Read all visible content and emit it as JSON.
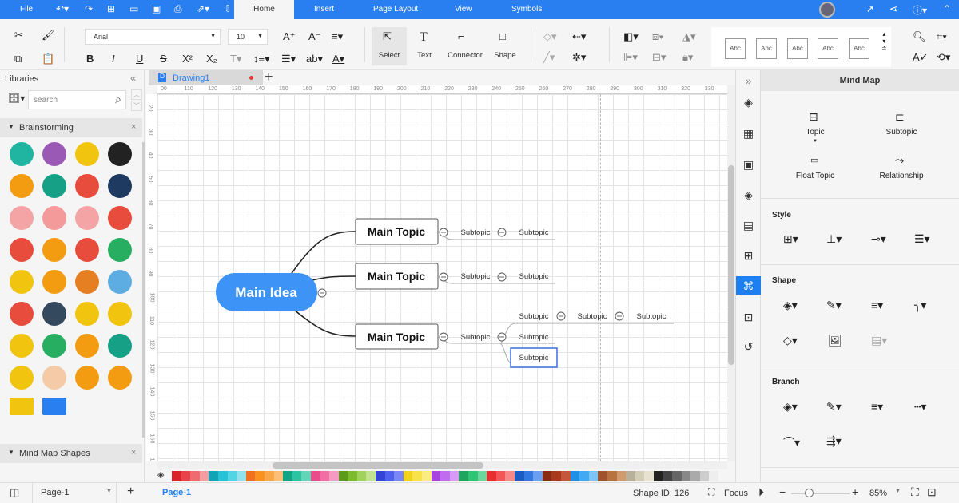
{
  "menu": {
    "file": "File",
    "tabs": [
      "Home",
      "Insert",
      "Page Layout",
      "View",
      "Symbols"
    ]
  },
  "toolbar": {
    "font": "Arial",
    "font_size": "10",
    "select": "Select",
    "text": "Text",
    "connector": "Connector",
    "shape": "Shape",
    "styles": [
      "Abc",
      "Abc",
      "Abc",
      "Abc",
      "Abc"
    ]
  },
  "libraries": {
    "title": "Libraries",
    "search_placeholder": "search",
    "sections": [
      "Brainstorming",
      "Mind Map Shapes"
    ],
    "icons": [
      "head-bulb",
      "head-brain-pink",
      "head-gears",
      "head-silhouette",
      "head-idea",
      "head-thermometer",
      "head-magnet",
      "head-brain-blue",
      "brain-pink",
      "brain-halves",
      "brain-pink-2",
      "brain-lightning",
      "gears-red",
      "wrench-idea",
      "people-talk",
      "eye",
      "question-bubble",
      "explosion",
      "explosion-2",
      "whiteboard",
      "checklist",
      "notepad-pen",
      "notes-pencil",
      "bulb-yellow",
      "bulb-glow",
      "bulb-gear",
      "bulb-tree",
      "bulb-hand",
      "bulb-plain",
      "hand-idea",
      "magnifier",
      "bulb-small",
      "bulb-cable",
      "phone"
    ]
  },
  "document": {
    "tab": "Drawing1"
  },
  "ruler": {
    "top": [
      "00",
      "110",
      "120",
      "130",
      "140",
      "150",
      "160",
      "170",
      "180",
      "190",
      "200",
      "210",
      "220",
      "230",
      "240",
      "250",
      "260",
      "270",
      "280",
      "290",
      "300",
      "310",
      "320",
      "330",
      "340",
      "35"
    ],
    "left": [
      "20",
      "30",
      "40",
      "50",
      "60",
      "70",
      "80",
      "90",
      "100",
      "110",
      "120",
      "130",
      "140",
      "150",
      "160",
      "170"
    ]
  },
  "mindmap": {
    "main_idea": "Main Idea",
    "topics": [
      "Main Topic",
      "Main Topic",
      "Main Topic"
    ],
    "subtopic": "Subtopic",
    "main_color": "#3d94f6"
  },
  "right_panel": {
    "title": "Mind Map",
    "topic": "Topic",
    "subtopic": "Subtopic",
    "float_topic": "Float Topic",
    "relationship": "Relationship",
    "style": "Style",
    "shape": "Shape",
    "branch": "Branch"
  },
  "status": {
    "page_select": "Page-1",
    "page_tab": "Page-1",
    "shape_id": "Shape ID: 126",
    "focus": "Focus",
    "zoom": "85%",
    "zoom_level": 0.3
  },
  "palette": [
    "#d9232a",
    "#e8434b",
    "#f06b70",
    "#f59da0",
    "#12a3b5",
    "#27c2d6",
    "#52d4e4",
    "#8fe3ee",
    "#f27121",
    "#f7931e",
    "#faa74a",
    "#fbbf78",
    "#11a585",
    "#2cc3a0",
    "#62d5b9",
    "#e84c8b",
    "#f06ea4",
    "#f59bc1",
    "#5c9a1b",
    "#7dbb2c",
    "#a1d25b",
    "#c2e28f",
    "#3343d6",
    "#5060ee",
    "#7a86f5",
    "#f2d31b",
    "#f7e24a",
    "#faec80",
    "#a943e0",
    "#c06cee",
    "#d89bf5",
    "#1ea55f",
    "#2ec476",
    "#6ad79d",
    "#e62e2e",
    "#f25656",
    "#f78888",
    "#1c5bc3",
    "#3477e0",
    "#6a9ef0",
    "#8b2a12",
    "#a8391c",
    "#c4573a",
    "#1e90e6",
    "#42aaf2",
    "#7cc4f7",
    "#a0522d",
    "#b8723f",
    "#d09a6d",
    "#b8b09a",
    "#d3cdb8",
    "#e6e1d0",
    "#222222",
    "#444444",
    "#666666",
    "#888888",
    "#aaaaaa",
    "#cccccc",
    "#eeeeee"
  ]
}
